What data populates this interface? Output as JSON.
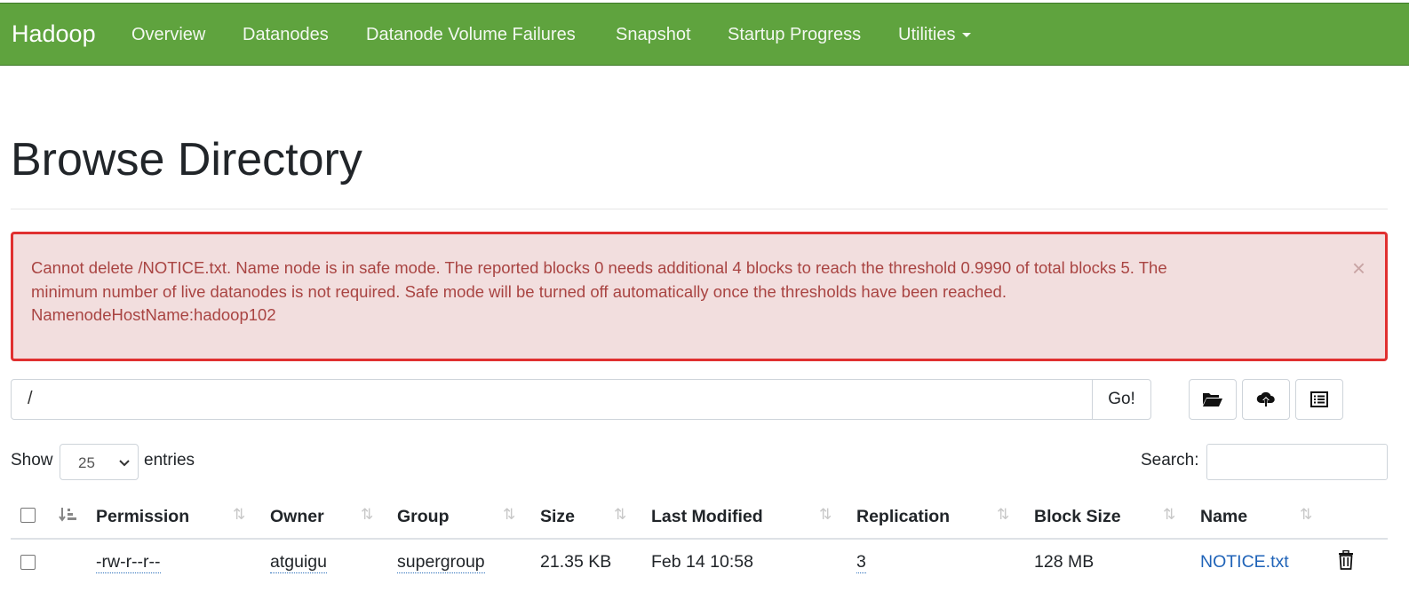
{
  "navbar": {
    "brand": "Hadoop",
    "items": [
      "Overview",
      "Datanodes",
      "Datanode Volume Failures",
      "Snapshot",
      "Startup Progress",
      "Utilities"
    ]
  },
  "page_title": "Browse Directory",
  "alert": {
    "lines": [
      "Cannot delete /NOTICE.txt. Name node is in safe mode. The reported blocks 0 needs additional 4 blocks to reach the threshold 0.9990 of total blocks 5. The",
      "minimum number of live datanodes is not required. Safe mode will be turned off automatically once the thresholds have been reached.",
      "NamenodeHostName:hadoop102"
    ],
    "close": "×"
  },
  "path_bar": {
    "value": "/",
    "go_label": "Go!"
  },
  "entries": {
    "show": "Show",
    "selected": "25",
    "suffix": "entries",
    "search_label": "Search:"
  },
  "table": {
    "headers": [
      "Permission",
      "Owner",
      "Group",
      "Size",
      "Last Modified",
      "Replication",
      "Block Size",
      "Name"
    ],
    "rows": [
      {
        "permission": "-rw-r--r--",
        "owner": "atguigu",
        "group": "supergroup",
        "size": "21.35 KB",
        "last_modified": "Feb 14 10:58",
        "replication": "3",
        "block_size": "128 MB",
        "name": "NOTICE.txt"
      }
    ]
  },
  "icons": {
    "folder": "folder-open-icon",
    "upload": "cloud-upload-icon",
    "list": "list-alt-icon",
    "delete": "trash-icon"
  },
  "colors": {
    "navbar": "#5fa33e",
    "alert_bg": "#f2dede",
    "alert_text": "#a94442",
    "alert_border": "#e03030",
    "link": "#1f63b8"
  }
}
